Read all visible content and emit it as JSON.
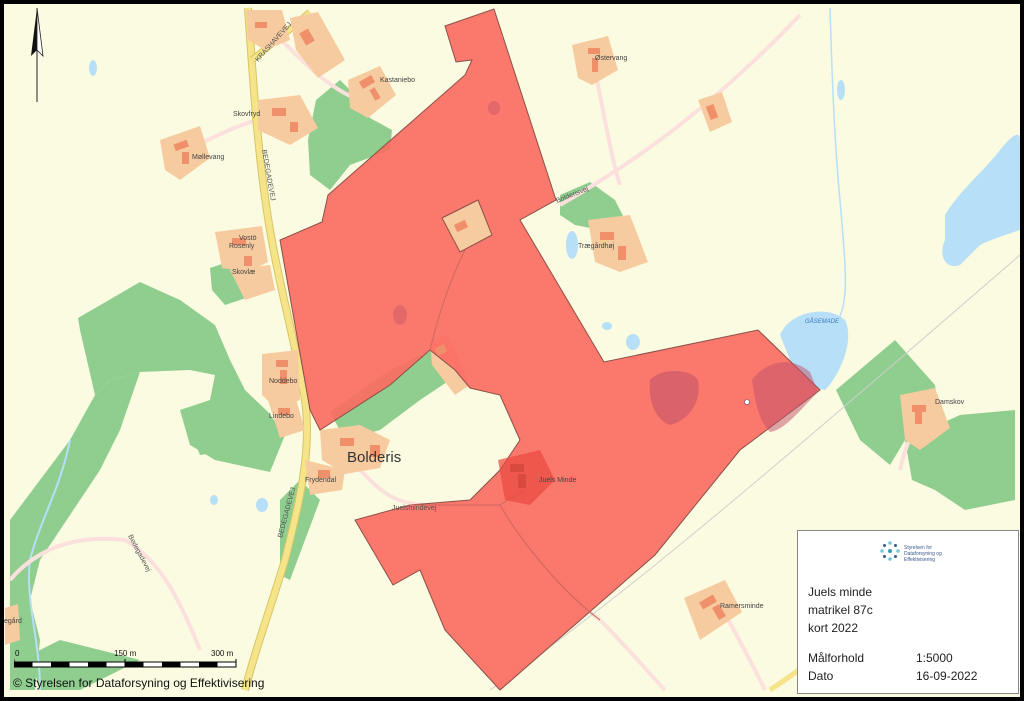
{
  "map": {
    "place_name": "Bolderis",
    "roads": [
      "KRASHAVEVEJ",
      "BEDEGADEVEJ",
      "BEDEGADEVEJ",
      "Bolderisvej",
      "Juelsmindevej",
      "Bedegadevej"
    ],
    "places": [
      "Kastaniebo",
      "Østervang",
      "Skovfryd",
      "Møllevang",
      "Vostö",
      "Rosenly",
      "Skovlæ",
      "Noddebo",
      "Lindebo",
      "Frydendal",
      "Trægårdhøj",
      "Juels Minde",
      "Damskov",
      "Ramersminde",
      "egård"
    ],
    "water_label": "GÅSEMADE"
  },
  "colors": {
    "background": "#fbfbe1",
    "forest": "#8fce8f",
    "parcel": "#fb6d62",
    "building_plot": "#f7cba0",
    "building": "#f0906a",
    "water": "#b7dff7",
    "road_major": "#f5e489"
  },
  "north_arrow": {
    "icon": "north-arrow-icon"
  },
  "scale": {
    "labels": [
      "0",
      "150 m",
      "300 m"
    ]
  },
  "copyright": "© Styrelsen for Dataforsyning og Effektivisering",
  "info": {
    "logo_text": "Styrelsen for Dataforsyning og Effektivisering",
    "title": "Juels minde",
    "subtitle": "matrikel 87c",
    "year": "kort 2022",
    "scale_label": "Målforhold",
    "scale_value": "1:5000",
    "date_label": "Dato",
    "date_value": "16-09-2022"
  }
}
